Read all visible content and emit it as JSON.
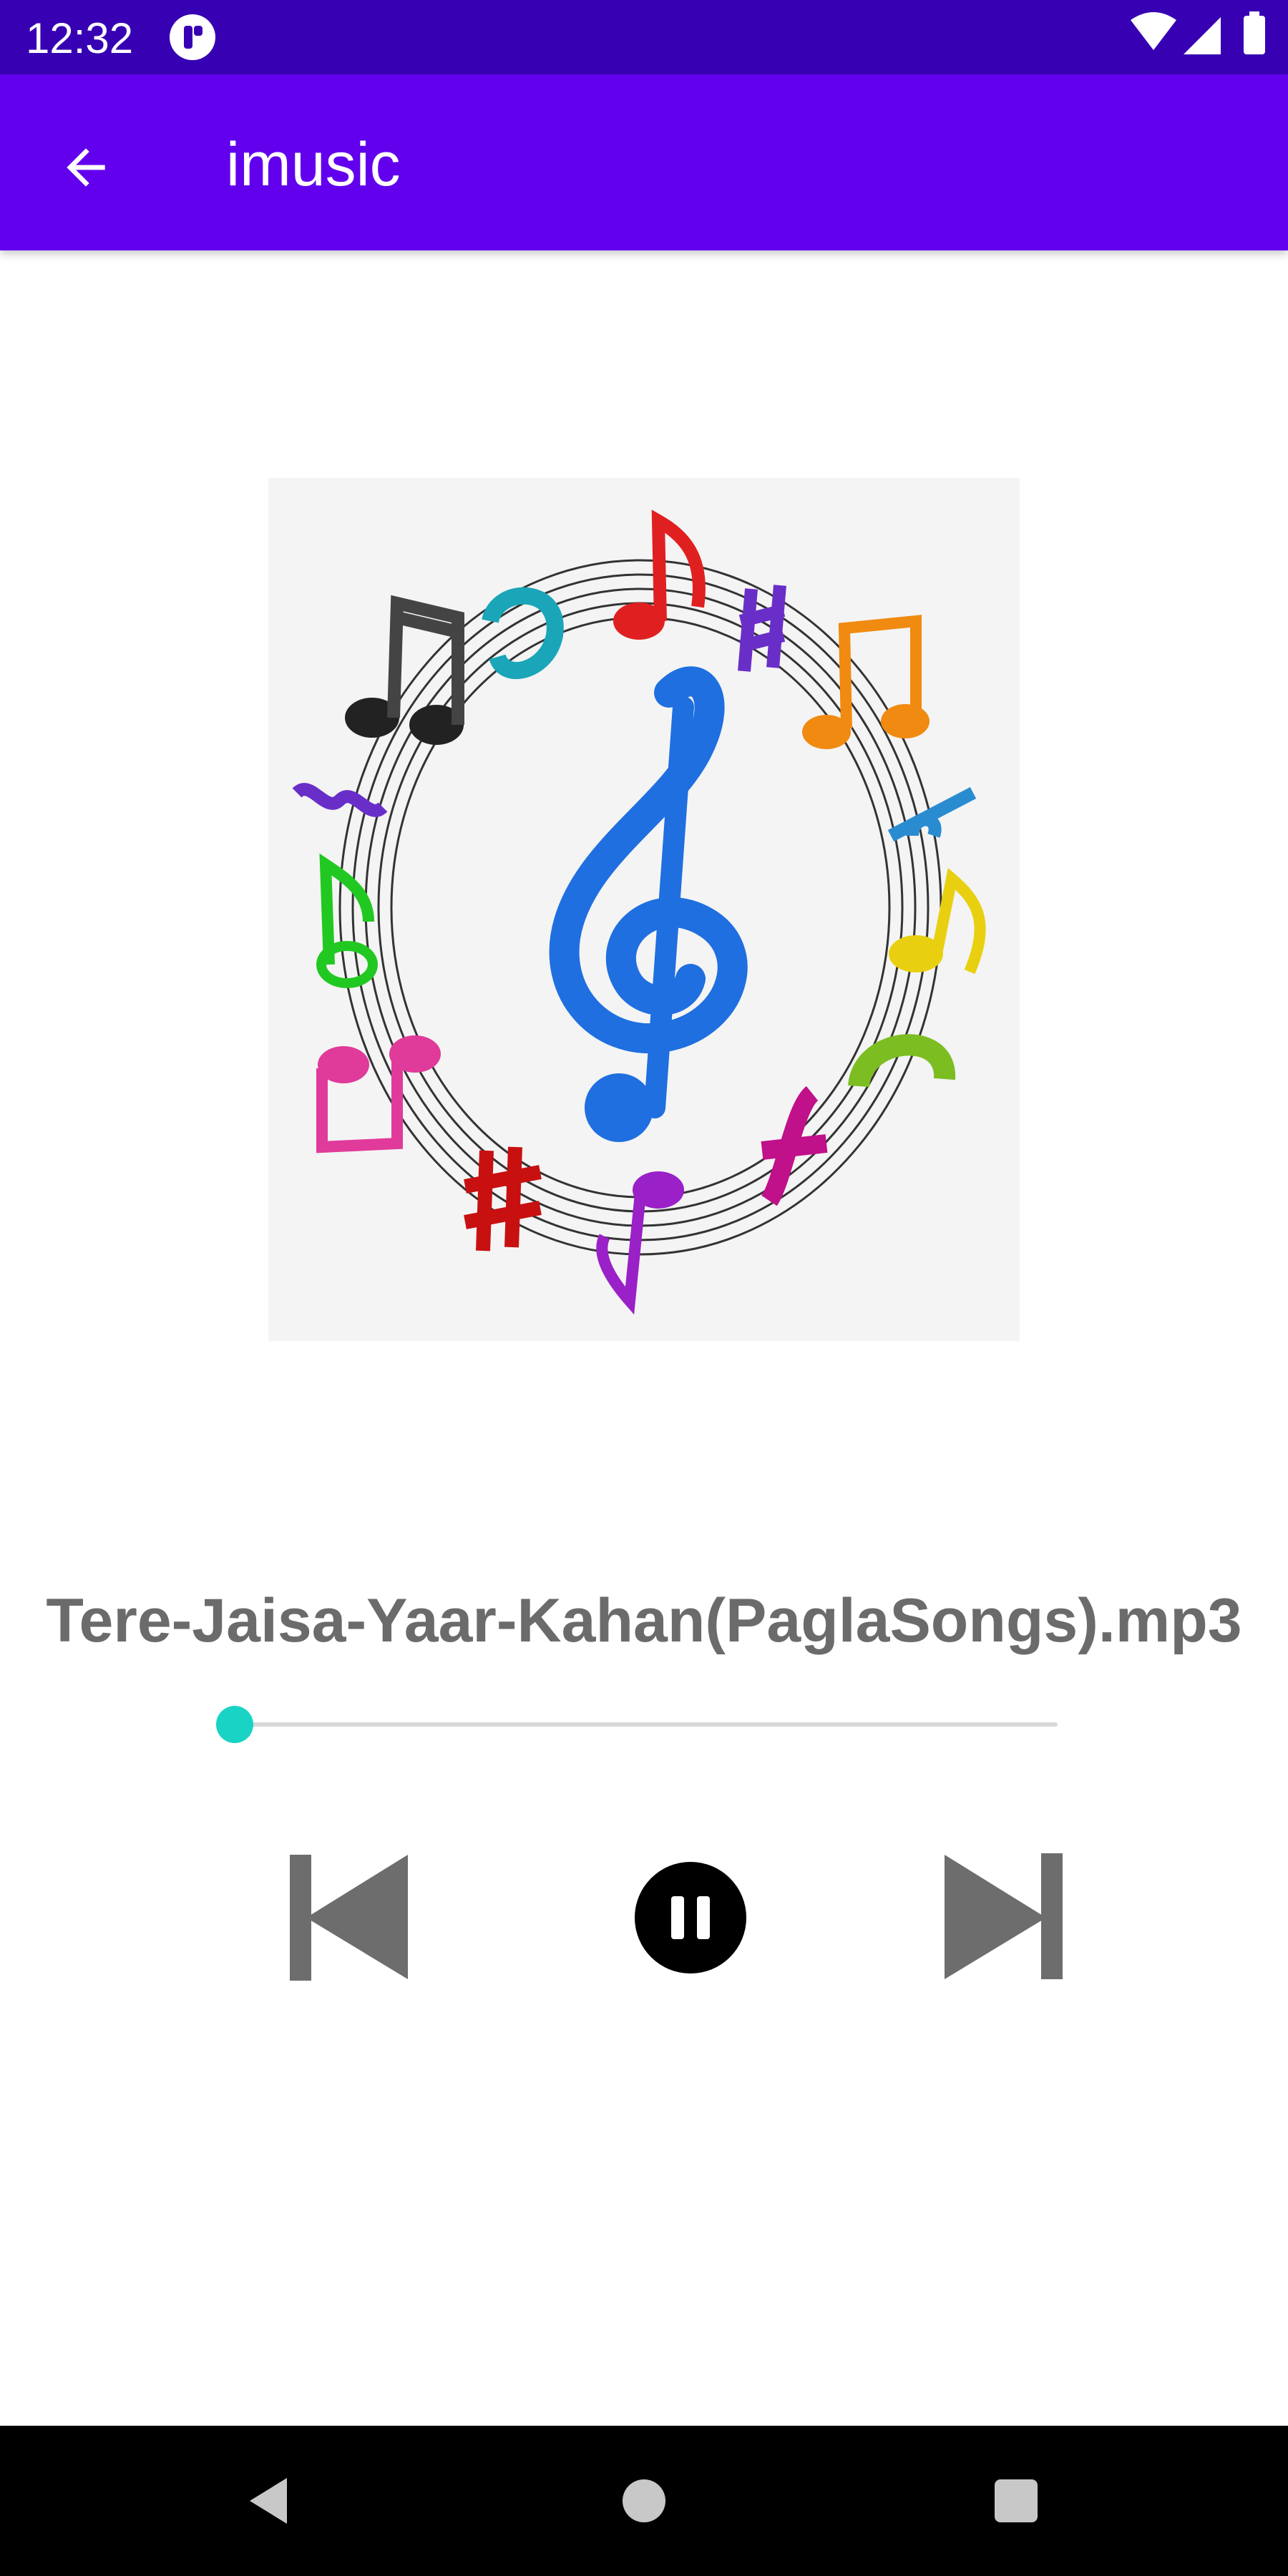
{
  "status_bar": {
    "time": "12:32",
    "icons": [
      "notification-app-icon",
      "wifi-icon",
      "cell-signal-icon",
      "battery-icon"
    ]
  },
  "app_bar": {
    "title": "imusic",
    "back_icon": "arrow-back-icon",
    "background": "#6200ee",
    "status_background": "#3700b3"
  },
  "player": {
    "song_title": "Tere-Jaisa-Yaar-Kahan(PaglaSongs).mp3",
    "progress_fraction": 0.0,
    "seek_color": "#19d3c5",
    "controls": {
      "previous_icon": "skip-previous-icon",
      "pause_icon": "pause-icon",
      "next_icon": "skip-next-icon"
    }
  },
  "nav_bar": {
    "buttons": [
      "back-triangle-icon",
      "home-circle-icon",
      "recents-square-icon"
    ]
  }
}
